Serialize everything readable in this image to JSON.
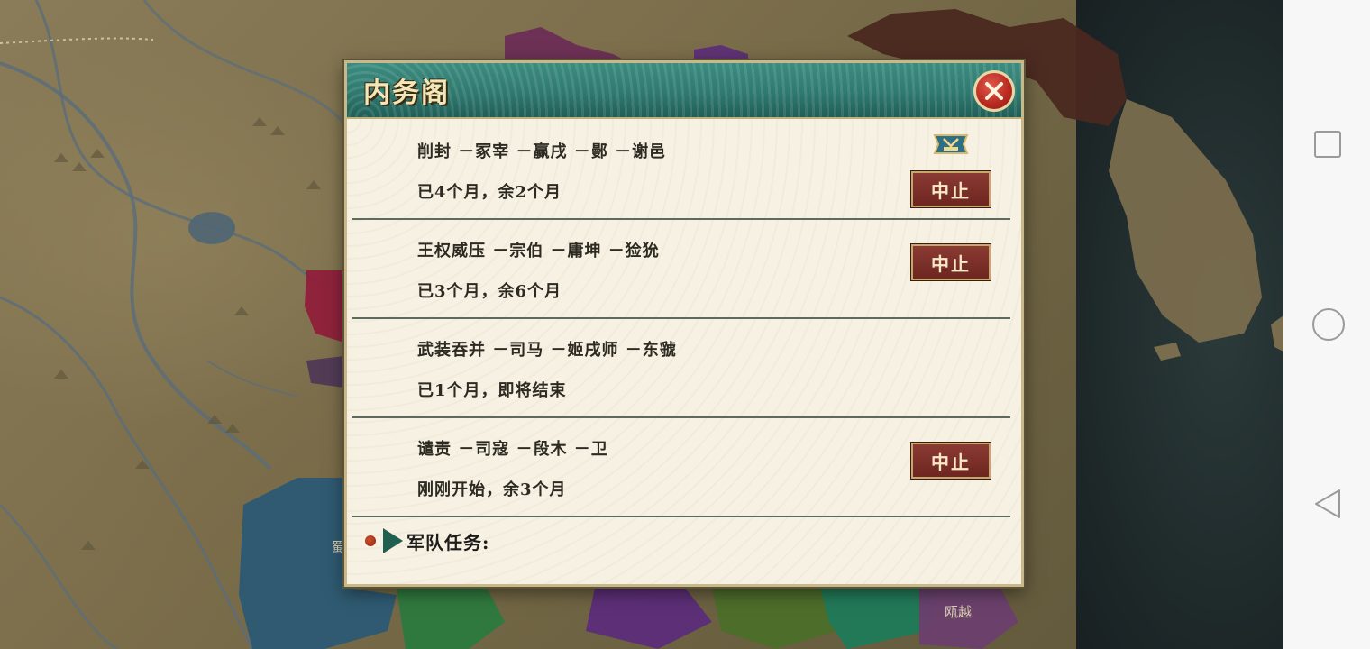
{
  "dialog": {
    "title": "内务阁",
    "close_icon": "close-icon"
  },
  "tasks": [
    {
      "name": "削封 －冢宰 －赢戌 －鄤 －谢邑",
      "progress": "已4个月，余2个月",
      "stop_label": "中止",
      "has_stop": true,
      "badge_icon": "official-rank-badge-icon"
    },
    {
      "name": "王权威压 －宗伯 －庸坤 －猃狁",
      "progress": "已3个月，余6个月",
      "stop_label": "中止",
      "has_stop": true
    },
    {
      "name": "武装吞并 －司马 －姬戌师 －东虢",
      "progress": "已1个月，即将结束",
      "has_stop": false
    },
    {
      "name": "谴责 －司寇 －段木 －卫",
      "progress": "刚刚开始，余3个月",
      "stop_label": "中止",
      "has_stop": true
    }
  ],
  "army_section": {
    "label": "军队任务:"
  },
  "map": {
    "labels": [
      "瓯越",
      "蜀"
    ]
  },
  "colors": {
    "header_teal": "#2f7a70",
    "stop_button": "#7a2e28",
    "parchment": "#f6f1e3"
  }
}
